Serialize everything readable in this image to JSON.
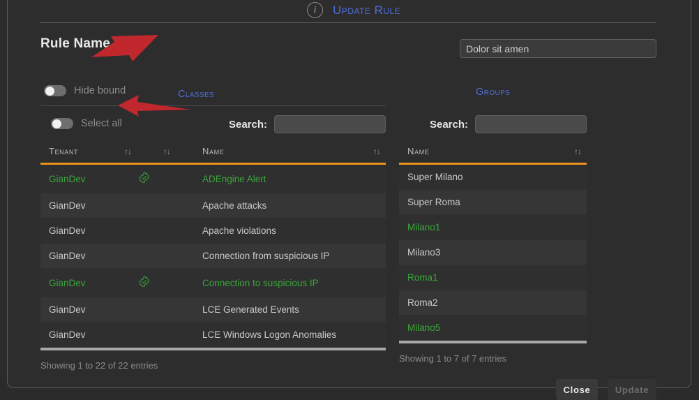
{
  "header": {
    "info_icon": "info-icon",
    "title": "Update Rule"
  },
  "form": {
    "rule_name_label": "Rule Name",
    "rule_name_value": "Dolor sit amen",
    "rule_name_placeholder": "",
    "hide_bound_label": "Hide bound",
    "hide_bound_on": false,
    "classes_link": "Classes",
    "groups_link": "Groups"
  },
  "classes_panel": {
    "select_all_label": "Select all",
    "select_all_on": false,
    "search_label": "Search:",
    "search_value": "",
    "search_placeholder": "",
    "columns": [
      "Tenant",
      "",
      "",
      "Name",
      ""
    ],
    "header_tenant": "Tenant",
    "header_name": "Name",
    "sort_glyph": "↑↓",
    "rows": [
      {
        "tenant": "GianDev",
        "name": "ADEngine Alert",
        "selected": true,
        "badge": "verified-icon"
      },
      {
        "tenant": "GianDev",
        "name": "Apache attacks",
        "selected": false,
        "badge": ""
      },
      {
        "tenant": "GianDev",
        "name": "Apache violations",
        "selected": false,
        "badge": ""
      },
      {
        "tenant": "GianDev",
        "name": "Connection from suspicious IP",
        "selected": false,
        "badge": ""
      },
      {
        "tenant": "GianDev",
        "name": "Connection to suspicious IP",
        "selected": true,
        "badge": "verified-icon"
      },
      {
        "tenant": "GianDev",
        "name": "LCE Generated Events",
        "selected": false,
        "badge": ""
      },
      {
        "tenant": "GianDev",
        "name": "LCE Windows Logon Anomalies",
        "selected": false,
        "badge": ""
      }
    ],
    "showing": "Showing 1 to 22 of 22 entries"
  },
  "groups_panel": {
    "search_label": "Search:",
    "search_value": "",
    "search_placeholder": "",
    "header_name": "Name",
    "sort_glyph": "↑↓",
    "rows": [
      {
        "name": "Super Milano",
        "selected": false
      },
      {
        "name": "Super Roma",
        "selected": false
      },
      {
        "name": "Milano1",
        "selected": true
      },
      {
        "name": "Milano3",
        "selected": false
      },
      {
        "name": "Roma1",
        "selected": true
      },
      {
        "name": "Roma2",
        "selected": false
      },
      {
        "name": "Milano5",
        "selected": true
      }
    ],
    "showing": "Showing 1 to 7 of 7 entries"
  },
  "footer": {
    "close_label": "Close",
    "update_label": "Update",
    "update_disabled": true
  },
  "annotations": {
    "arrow_1": "red-arrow-pointing-to-hide-bound-toggle",
    "arrow_2": "red-arrow-pointing-to-select-all-toggle"
  },
  "colors": {
    "accent_blue": "#4f6fd6",
    "accent_orange": "#e8911c",
    "selected_green": "#3aa63a",
    "annotation_red": "#c0282d",
    "background": "#2b2b2b"
  }
}
